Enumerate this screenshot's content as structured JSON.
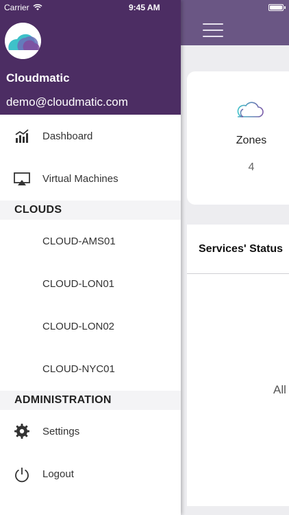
{
  "status_bar": {
    "carrier": "Carrier",
    "time": "9:45 AM"
  },
  "drawer": {
    "app_name": "Cloudmatic",
    "email": "demo@cloudmatic.com",
    "nav": [
      {
        "label": "Dashboard",
        "icon": "bar-chart-icon"
      },
      {
        "label": "Virtual Machines",
        "icon": "airplay-icon"
      }
    ],
    "clouds_header": "CLOUDS",
    "clouds": [
      {
        "label": "CLOUD-AMS01"
      },
      {
        "label": "CLOUD-LON01"
      },
      {
        "label": "CLOUD-LON02"
      },
      {
        "label": "CLOUD-NYC01"
      }
    ],
    "admin_header": "ADMINISTRATION",
    "admin": [
      {
        "label": "Settings",
        "icon": "gear-icon"
      },
      {
        "label": "Logout",
        "icon": "power-icon"
      }
    ]
  },
  "main": {
    "zones": {
      "title": "Zones",
      "count": "4"
    },
    "services": {
      "title": "Services' Status",
      "status_text": "All"
    }
  },
  "colors": {
    "drawer_header": "#4c2d63",
    "main_header": "#6a5684",
    "accent_teal": "#3ec1c9"
  }
}
